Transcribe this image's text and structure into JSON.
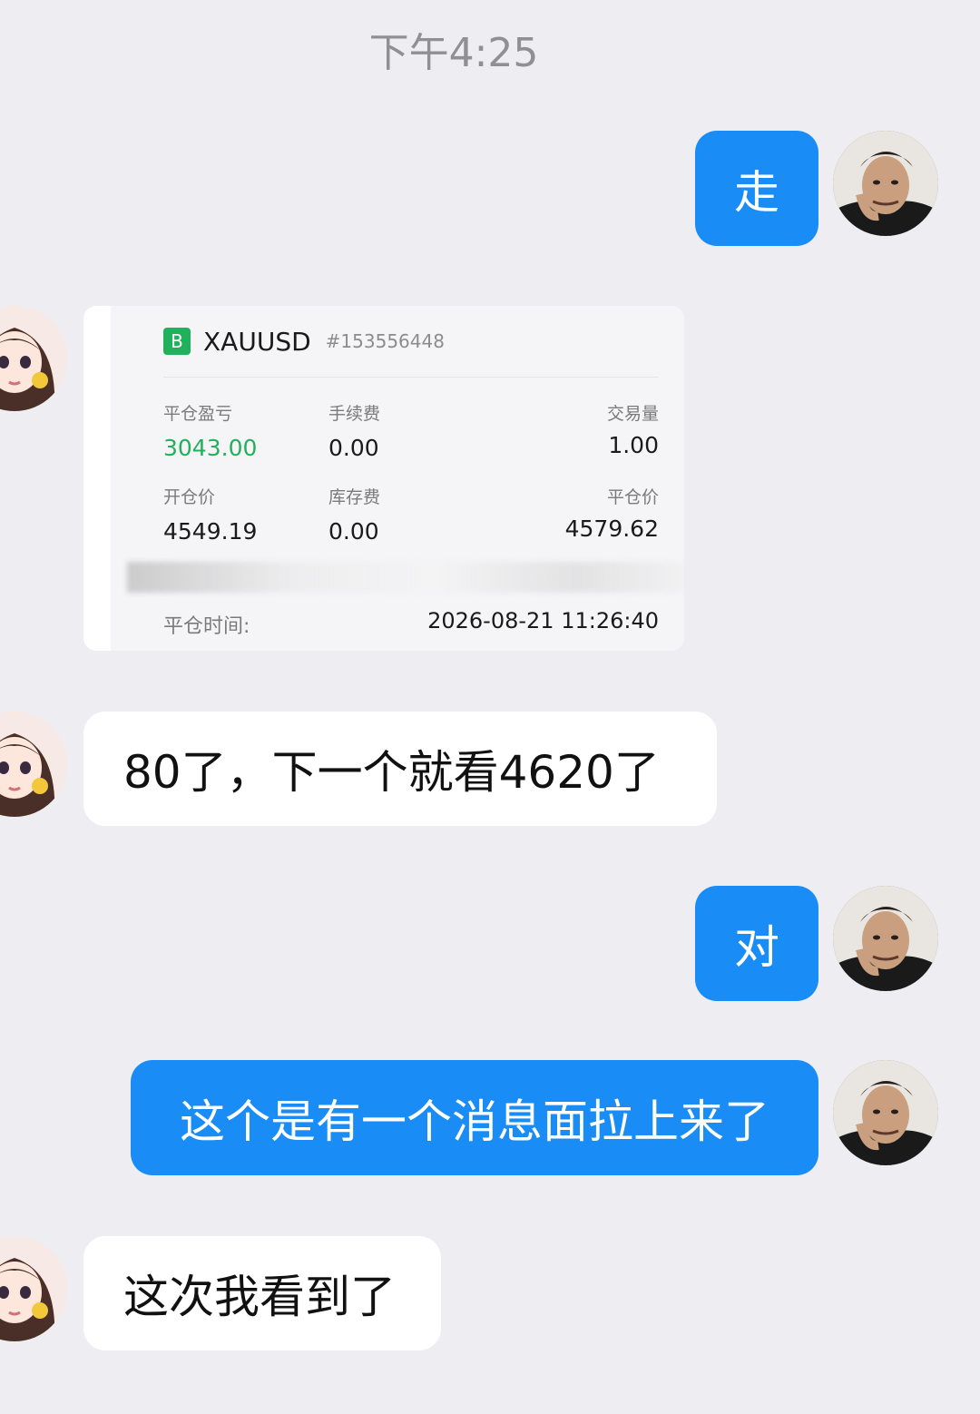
{
  "header": {
    "time": "下午4:25"
  },
  "messages": {
    "m1": {
      "text": "走"
    },
    "m3": {
      "text": "80了，下一个就看4620了"
    },
    "m4": {
      "text": "对"
    },
    "m5": {
      "text": "这个是有一个消息面拉上来了"
    },
    "m6": {
      "text": "这次我看到了"
    }
  },
  "trade_card": {
    "badge": "B",
    "symbol": "XAUUSD",
    "order_id": "#153556448",
    "close_pnl_label": "平仓盈亏",
    "close_pnl_value": "3043.00",
    "fee_label": "手续费",
    "fee_value": "0.00",
    "volume_label": "交易量",
    "volume_value": "1.00",
    "open_price_label": "开仓价",
    "open_price_value": "4549.19",
    "swap_label": "库存费",
    "swap_value": "0.00",
    "close_price_label": "平仓价",
    "close_price_value": "4579.62",
    "close_time_label": "平仓时间:",
    "close_time_value": "2026-08-21 11:26:40"
  },
  "colors": {
    "outgoing_bubble": "#1a8cf5",
    "incoming_bubble": "#ffffff",
    "background": "#ededf2",
    "profit_green": "#21b15c"
  }
}
